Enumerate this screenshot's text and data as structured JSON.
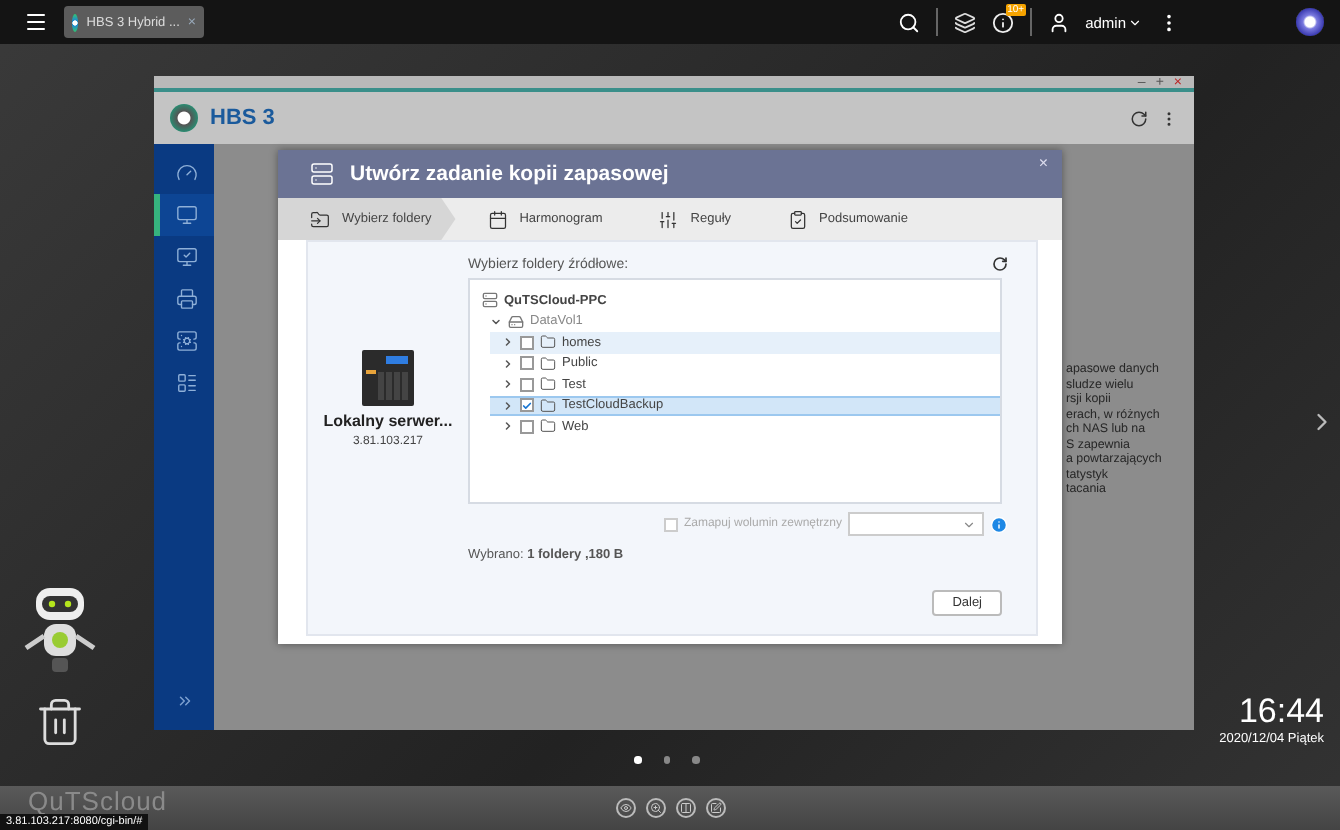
{
  "top_bar": {
    "tab": {
      "title": "HBS 3 Hybrid ...",
      "close": "×"
    },
    "notification_badge": "10+",
    "user": "admin"
  },
  "app": {
    "title": "HBS 3",
    "window_controls": [
      "–",
      "+",
      "×"
    ],
    "sidebar": [
      {
        "selected": false
      },
      {
        "selected": true
      },
      {
        "selected": false
      },
      {
        "selected": false
      },
      {
        "selected": false
      },
      {
        "selected": false
      }
    ],
    "background_text": [
      "apasowe danych",
      "sludze wielu",
      "rsji kopii",
      "erach, w różnych",
      "ch NAS lub na",
      "S zapewnia",
      "a powtarzających",
      "tatystyk",
      "tacania"
    ]
  },
  "dialog": {
    "title": "Utwórz zadanie kopii zapasowej",
    "close": "×",
    "steps": [
      {
        "label": "Wybierz foldery",
        "selected": true
      },
      {
        "label": "Harmonogram",
        "selected": false
      },
      {
        "label": "Reguły",
        "selected": false
      },
      {
        "label": "Podsumowanie",
        "selected": false
      }
    ],
    "server": {
      "name": "Lokalny serwer...",
      "ip": "3.81.103.217"
    },
    "source_label": "Wybierz foldery źródłowe:",
    "tree": {
      "label": "QuTSCloud-PPC",
      "children": [
        {
          "label": "DataVol1",
          "expanded": true,
          "children": [
            {
              "label": "homes",
              "expanded": false,
              "checked": false,
              "highlighted": true,
              "selected": false
            },
            {
              "label": "Public",
              "expanded": false,
              "checked": false,
              "highlighted": false,
              "selected": false
            },
            {
              "label": "Test",
              "expanded": false,
              "checked": false,
              "highlighted": false,
              "selected": false
            },
            {
              "label": "TestCloudBackup",
              "expanded": false,
              "checked": true,
              "highlighted": false,
              "selected": true
            },
            {
              "label": "Web",
              "expanded": false,
              "checked": false,
              "highlighted": false,
              "selected": false
            }
          ]
        }
      ]
    },
    "map_external": {
      "label": "Zamapuj wolumin zewnętrzny",
      "checked": false,
      "disabled": true
    },
    "summary": "Wybrano: **1 foldery ,180 B**",
    "next_button": "Dalej"
  },
  "desktop": {
    "clock": "16:44",
    "date": "2020/12/04 Piątek",
    "pages": [
      {
        "selected": true
      },
      {
        "selected": false
      },
      {
        "selected": false
      }
    ],
    "brand": "QuTScloud",
    "status_url": "3.81.103.217:8080/cgi-bin/#"
  }
}
